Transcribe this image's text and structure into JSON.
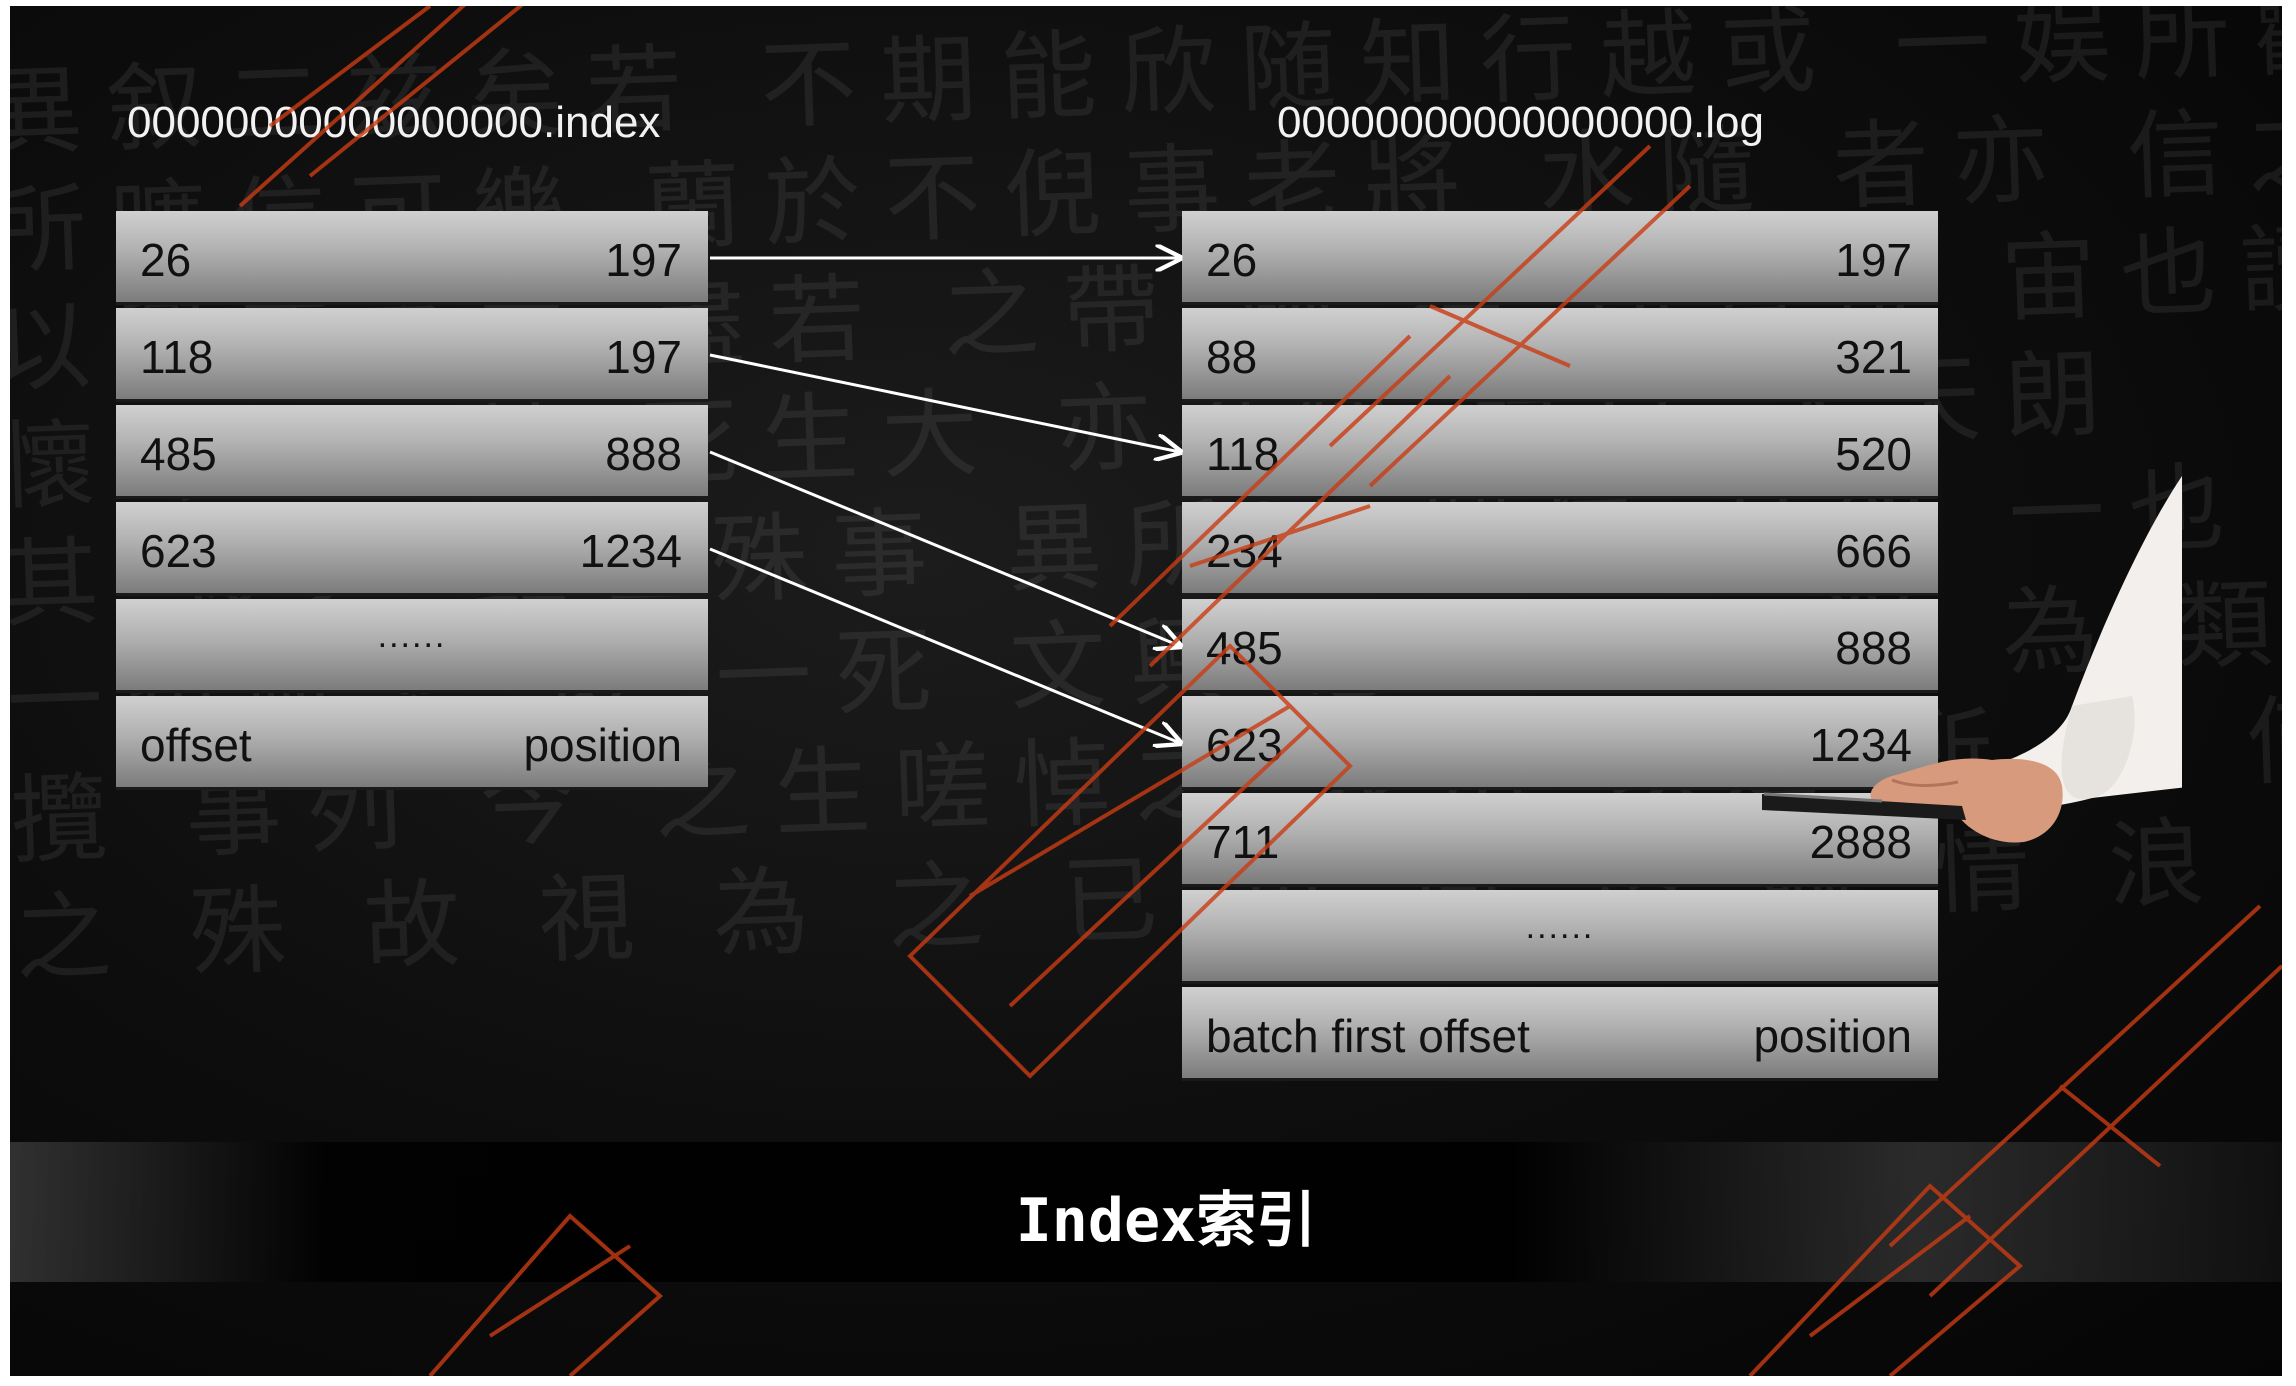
{
  "index_table": {
    "title": "00000000000000000.index",
    "rows": [
      {
        "offset": "26",
        "position": "197"
      },
      {
        "offset": "118",
        "position": "197"
      },
      {
        "offset": "485",
        "position": "888"
      },
      {
        "offset": "623",
        "position": "1234"
      }
    ],
    "ellipsis": "......",
    "header": {
      "offset": "offset",
      "position": "position"
    }
  },
  "log_table": {
    "title": "00000000000000000.log",
    "rows": [
      {
        "offset": "26",
        "position": "197"
      },
      {
        "offset": "88",
        "position": "321"
      },
      {
        "offset": "118",
        "position": "520"
      },
      {
        "offset": "234",
        "position": "666"
      },
      {
        "offset": "485",
        "position": "888"
      },
      {
        "offset": "623",
        "position": "1234"
      },
      {
        "offset": "711",
        "position": "2888"
      }
    ],
    "ellipsis": "......",
    "header": {
      "offset": "batch first offset",
      "position": "position"
    }
  },
  "arrows": [
    {
      "from_index_row": 0,
      "to_log_row": 0
    },
    {
      "from_index_row": 1,
      "to_log_row": 2
    },
    {
      "from_index_row": 2,
      "to_log_row": 4
    },
    {
      "from_index_row": 3,
      "to_log_row": 5
    }
  ],
  "caption": "Index索引",
  "colors": {
    "background": "#0d0d0d",
    "cell_light": "#d0d0d0",
    "cell_dark": "#7c7c7c",
    "arrow": "#ffffff",
    "watermark": "#c83c14"
  }
}
